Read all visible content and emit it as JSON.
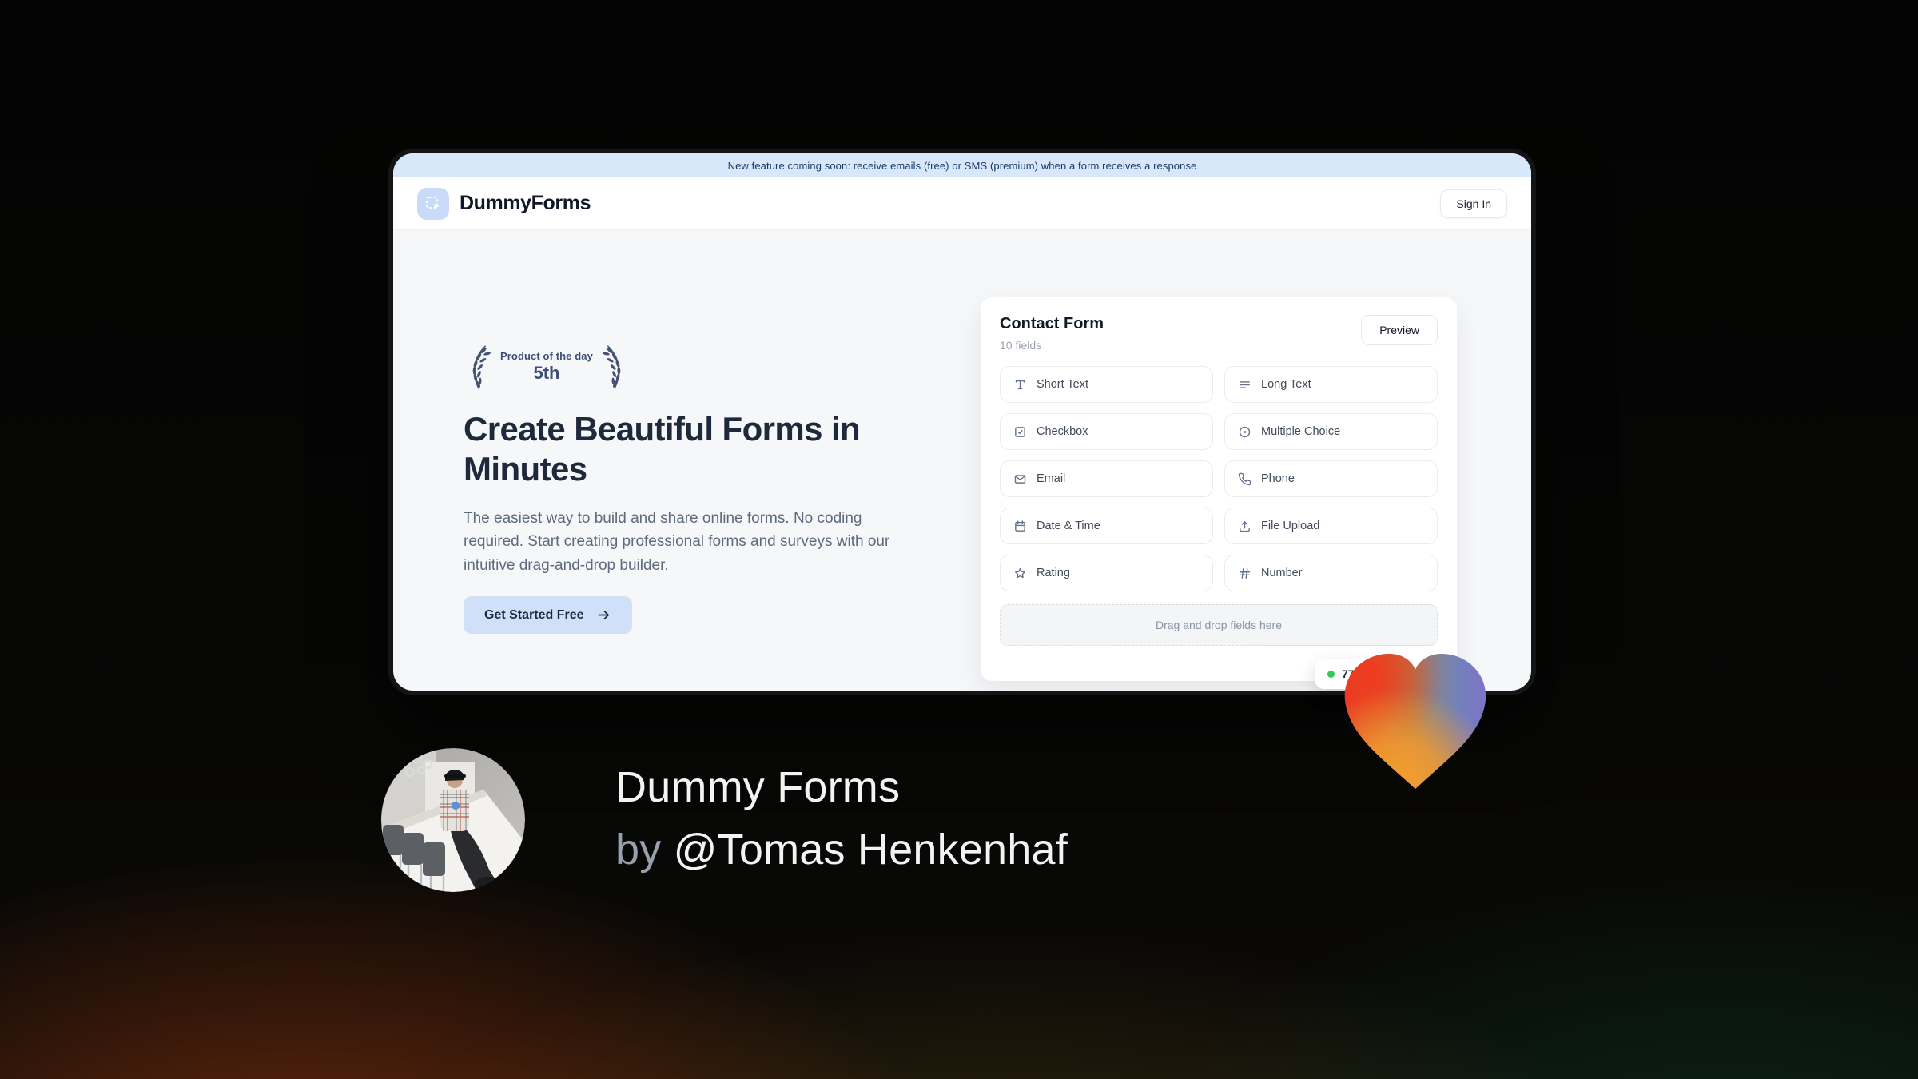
{
  "banner": {
    "text": "New feature coming soon: receive emails (free) or SMS (premium) when a form receives a response"
  },
  "header": {
    "brand": "DummyForms",
    "sign_in_label": "Sign In"
  },
  "hero": {
    "award": {
      "title": "Product of the day",
      "rank": "5th"
    },
    "title": "Create Beautiful Forms in Minutes",
    "description": "The easiest way to build and share online forms. No coding required. Start creating professional forms and surveys with our intuitive drag-and-drop builder.",
    "cta_label": "Get Started Free"
  },
  "form_card": {
    "title": "Contact Form",
    "field_count": "10 fields",
    "preview_label": "Preview",
    "fields": [
      {
        "label": "Short Text",
        "icon": "short-text-icon"
      },
      {
        "label": "Long Text",
        "icon": "long-text-icon"
      },
      {
        "label": "Checkbox",
        "icon": "checkbox-icon"
      },
      {
        "label": "Multiple Choice",
        "icon": "multiple-choice-icon"
      },
      {
        "label": "Email",
        "icon": "email-icon"
      },
      {
        "label": "Phone",
        "icon": "phone-icon"
      },
      {
        "label": "Date & Time",
        "icon": "calendar-icon"
      },
      {
        "label": "File Upload",
        "icon": "upload-icon"
      },
      {
        "label": "Rating",
        "icon": "star-icon"
      },
      {
        "label": "Number",
        "icon": "hash-icon"
      }
    ],
    "dropzone_text": "Drag and drop fields here"
  },
  "toast": {
    "count": "77"
  },
  "caption": {
    "line1": "Dummy Forms",
    "by_word": "by",
    "author": "@Tomas Henkenhaf"
  },
  "colors": {
    "accent_blue": "#cfe0f8",
    "banner_bg": "#d9e7fb",
    "toast_dot_green": "#34c759",
    "heart_red": "#e63b2a",
    "heart_orange": "#f59b2d",
    "heart_purple": "#7d74c6"
  }
}
